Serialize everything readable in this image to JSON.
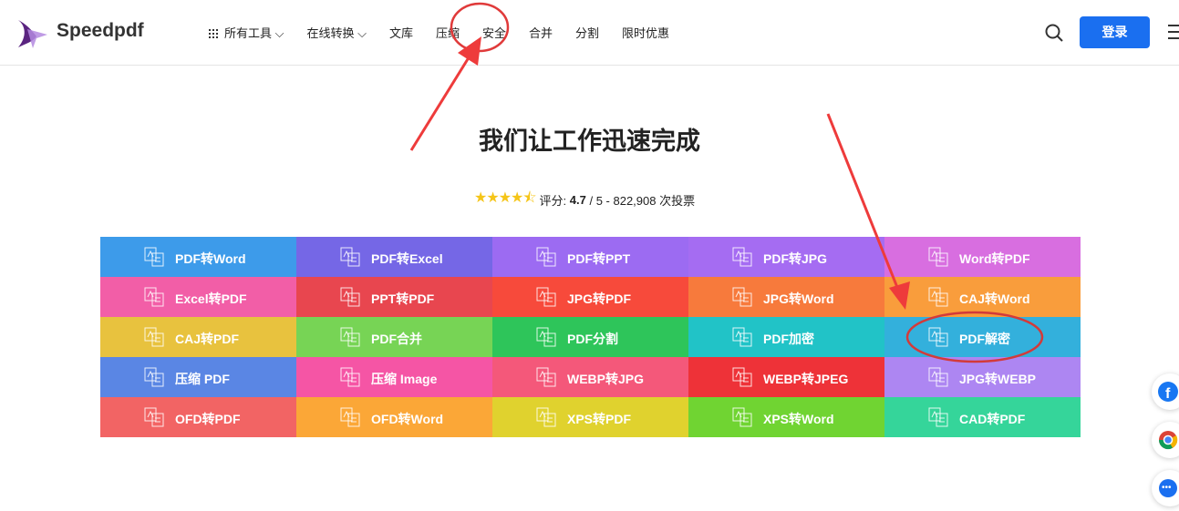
{
  "header": {
    "brand": "Speedpdf",
    "nav": [
      "所有工具",
      "在线转换",
      "文库",
      "压缩",
      "安全",
      "合并",
      "分割",
      "限时优惠"
    ],
    "login": "登录"
  },
  "hero": {
    "title": "我们让工作迅速完成",
    "rating_label": "评分:",
    "rating_value": "4.7",
    "rating_rest": "/ 5 - 822,908 次投票",
    "stars": 4.5
  },
  "tiles": [
    {
      "label": "PDF转Word",
      "color": "#3d9bea"
    },
    {
      "label": "PDF转Excel",
      "color": "#7567e6"
    },
    {
      "label": "PDF转PPT",
      "color": "#9c6bf2"
    },
    {
      "label": "PDF转JPG",
      "color": "#a56cf2"
    },
    {
      "label": "Word转PDF",
      "color": "#d86ee0"
    },
    {
      "label": "Excel转PDF",
      "color": "#f25ea7"
    },
    {
      "label": "PPT转PDF",
      "color": "#e8464f"
    },
    {
      "label": "JPG转PDF",
      "color": "#f74a3b"
    },
    {
      "label": "JPG转Word",
      "color": "#f77a3c"
    },
    {
      "label": "CAJ转Word",
      "color": "#f99d3c"
    },
    {
      "label": "CAJ转PDF",
      "color": "#e8c23e"
    },
    {
      "label": "PDF合并",
      "color": "#77d455"
    },
    {
      "label": "PDF分割",
      "color": "#2ec55a"
    },
    {
      "label": "PDF加密",
      "color": "#21c3c7"
    },
    {
      "label": "PDF解密",
      "color": "#33b0dc"
    },
    {
      "label": "压缩 PDF",
      "color": "#5a86e4"
    },
    {
      "label": "压缩 Image",
      "color": "#f555a5"
    },
    {
      "label": "WEBP转JPG",
      "color": "#f4587a"
    },
    {
      "label": "WEBP转JPEG",
      "color": "#ee3238"
    },
    {
      "label": "JPG转WEBP",
      "color": "#ad86f2"
    },
    {
      "label": "OFD转PDF",
      "color": "#f26464"
    },
    {
      "label": "OFD转Word",
      "color": "#fba737"
    },
    {
      "label": "XPS转PDF",
      "color": "#e0d22e"
    },
    {
      "label": "XPS转Word",
      "color": "#70d432"
    },
    {
      "label": "CAD转PDF",
      "color": "#35d59a"
    }
  ],
  "side_icons": [
    "facebook-icon",
    "chrome-icon",
    "chat-icon"
  ]
}
